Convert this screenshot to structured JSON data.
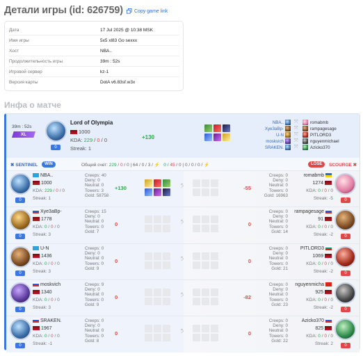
{
  "header": {
    "title": "Детали игры (id: 626759)",
    "copy_link": "Copy game link"
  },
  "info": [
    {
      "k": "Дата",
      "v": "17 Jul 2025 @ 10:38 MSK"
    },
    {
      "k": "Имя игры",
      "v": "5x5 xl83 Go sexxx"
    },
    {
      "k": "Хост",
      "v": "NBA.."
    },
    {
      "k": "Продолжительность игры",
      "v": "39m : 52s"
    },
    {
      "k": "Игровой сервер",
      "v": "kz-1"
    },
    {
      "k": "Версия карты",
      "v": "DotA v6.83sf.w3x"
    }
  ],
  "section_title": "Инфа о матче",
  "mvp": {
    "duration": "39m : 52s",
    "badge": "XL",
    "name": "Lord of Olympia",
    "rating": "1000",
    "kda_label": "KDA:",
    "k": "229",
    "d": "0",
    "a": "0",
    "streak": "Streak: 1",
    "delta": "+130",
    "level": "0",
    "sentinel": [
      "NBA..",
      "Xye3aBp-",
      "U-N",
      "moskvich",
      "SRAKEN."
    ],
    "scourge": [
      "romabmb",
      "rampagesage",
      "PITLORD3",
      "nguyenmichael",
      "Azicko370"
    ]
  },
  "teams": {
    "sentinel": "SENTINEL",
    "win": "WIN",
    "lose": "LOSE",
    "scourge": "SCOURGE",
    "score_label": "Общий счет:",
    "s_k": "229",
    "s_d": "0",
    "s_a": "0",
    "s_t": "64",
    "s_x": "0",
    "s_y": "3",
    "sc_k": "0",
    "sc_d": "45",
    "sc_a": "0",
    "sc_t": "0",
    "sc_x": "0",
    "sc_y": "0"
  },
  "rows": [
    {
      "l_name": "NBA..",
      "l_rating": "1000",
      "l_k": "229",
      "l_d": "0",
      "l_a": "0",
      "l_streak": "Streak: 1",
      "l_lvl": "0",
      "l_creeps": "Creeps: 40",
      "l_deny": "Deny: 0",
      "l_neutral": "Neutral: 0",
      "l_towers": "Towers: 3",
      "l_gold": "Gold: 58758",
      "l_delta": "+130",
      "r_name": "romabmb",
      "r_rating": "1274",
      "r_k": "0",
      "r_d": "0",
      "r_a": "0",
      "r_streak": "Streak: -5",
      "r_lvl": "0",
      "r_creeps": "Creeps: 0",
      "r_deny": "Deny: 0",
      "r_neutral": "Neutral: 0",
      "r_towers": "Towers: 0",
      "r_gold": "Gold: 16963",
      "r_delta": "-55"
    },
    {
      "l_name": "Xye3aBp-",
      "l_rating": "1778",
      "l_k": "0",
      "l_d": "0",
      "l_a": "0",
      "l_streak": "Streak: 3",
      "l_lvl": "0",
      "l_creeps": "Creeps: 15",
      "l_deny": "Deny: 0",
      "l_neutral": "Neutral: 0",
      "l_towers": "Towers: 0",
      "l_gold": "Gold: 7",
      "l_delta": "0",
      "r_name": "rampagesage",
      "r_rating": "91",
      "r_k": "0",
      "r_d": "0",
      "r_a": "0",
      "r_streak": "Streak: -2",
      "r_lvl": "0",
      "r_creeps": "Creeps: 0",
      "r_deny": "Deny: 0",
      "r_neutral": "Neutral: 0",
      "r_towers": "Towers: 0",
      "r_gold": "Gold: 14",
      "r_delta": "0"
    },
    {
      "l_name": "U-N",
      "l_rating": "1436",
      "l_k": "0",
      "l_d": "0",
      "l_a": "0",
      "l_streak": "Streak: 3",
      "l_lvl": "0",
      "l_creeps": "Creeps: 0",
      "l_deny": "Deny: 0",
      "l_neutral": "Neutral: 0",
      "l_towers": "Towers: 0",
      "l_gold": "Gold: 9",
      "l_delta": "0",
      "r_name": "PITLORD3",
      "r_rating": "1069",
      "r_k": "0",
      "r_d": "0",
      "r_a": "0",
      "r_streak": "Streak: -2",
      "r_lvl": "0",
      "r_creeps": "Creeps: 0",
      "r_deny": "Deny: 0",
      "r_neutral": "Neutral: 0",
      "r_towers": "Towers: 0",
      "r_gold": "Gold: 21",
      "r_delta": "0"
    },
    {
      "l_name": "moskvich",
      "l_rating": "1340",
      "l_k": "0",
      "l_d": "0",
      "l_a": "0",
      "l_streak": "Streak: 3",
      "l_lvl": "0",
      "l_creeps": "Creeps: 9",
      "l_deny": "Deny: 0",
      "l_neutral": "Neutral: 0",
      "l_towers": "Towers: 0",
      "l_gold": "Gold: 9",
      "l_delta": "0",
      "r_name": "nguyenmicha",
      "r_rating": "925",
      "r_k": "0",
      "r_d": "0",
      "r_a": "0",
      "r_streak": "Streak: -2",
      "r_lvl": "0",
      "r_creeps": "Creeps: 0",
      "r_deny": "Deny: 0",
      "r_neutral": "Neutral: 0",
      "r_towers": "Towers: 0",
      "r_gold": "Gold: 23",
      "r_delta": "-82"
    },
    {
      "l_name": "SRAKEN.",
      "l_rating": "1967",
      "l_k": "0",
      "l_d": "0",
      "l_a": "0",
      "l_streak": "Streak: -1",
      "l_lvl": "0",
      "l_creeps": "Creeps: 0",
      "l_deny": "Deny: 0",
      "l_neutral": "Neutral: 0",
      "l_towers": "Towers: 0",
      "l_gold": "Gold: 8",
      "l_delta": "0",
      "r_name": "Azicko370",
      "r_rating": "825",
      "r_k": "0",
      "r_d": "0",
      "r_a": "0",
      "r_streak": "Streak: 2",
      "r_lvl": "0",
      "r_creeps": "Creeps: 0",
      "r_deny": "Deny: 0",
      "r_neutral": "Neutral: 0",
      "r_towers": "Towers: 0",
      "r_gold": "Gold: 22",
      "r_delta": "0"
    }
  ]
}
